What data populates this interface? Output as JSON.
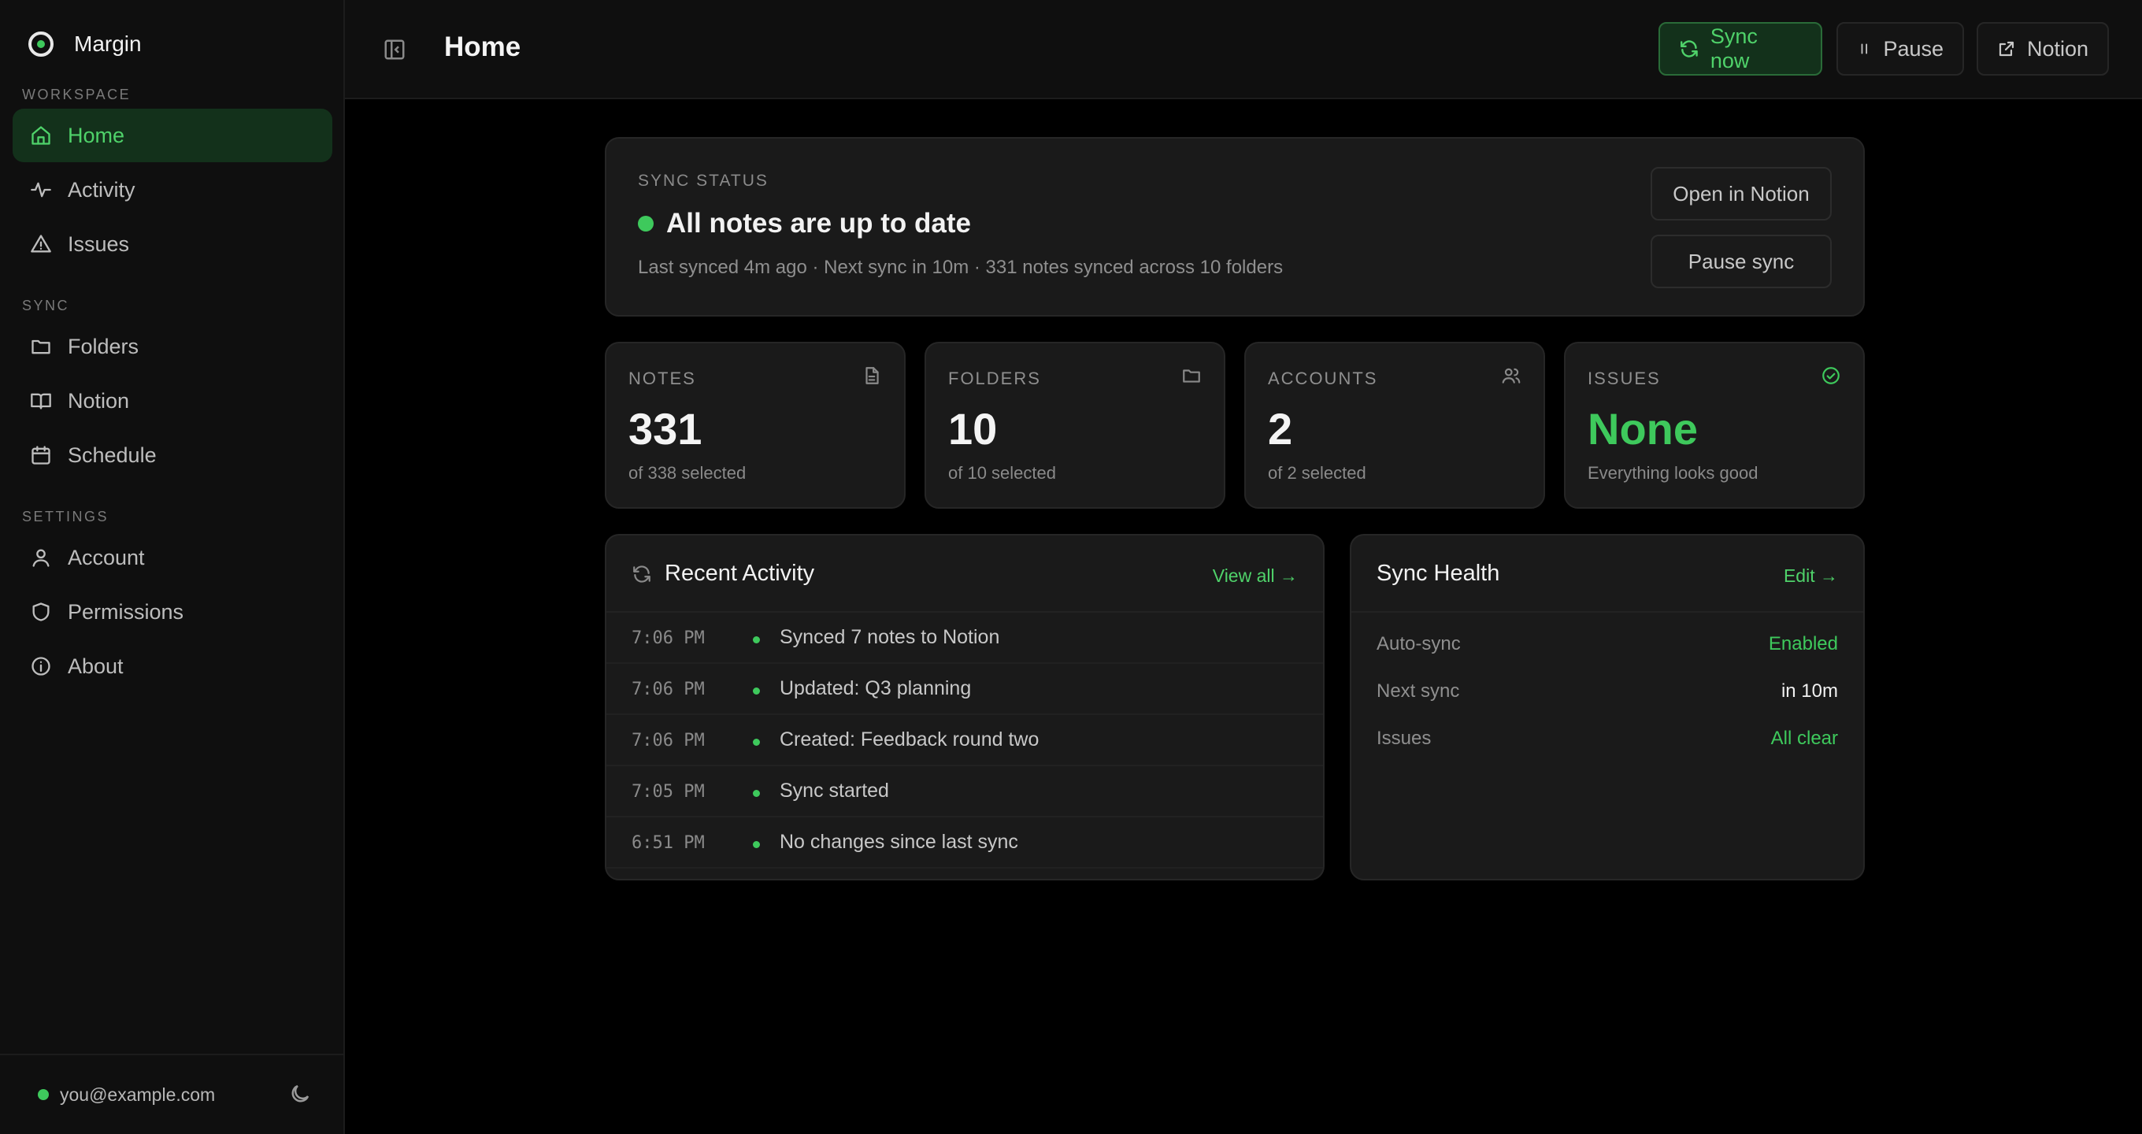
{
  "app": {
    "name": "Margin"
  },
  "sidebar": {
    "sections": [
      {
        "label": "WORKSPACE",
        "items": [
          {
            "label": "Home",
            "icon": "home-icon",
            "active": true
          },
          {
            "label": "Activity",
            "icon": "activity-icon"
          },
          {
            "label": "Issues",
            "icon": "warning-icon"
          }
        ]
      },
      {
        "label": "SYNC",
        "items": [
          {
            "label": "Folders",
            "icon": "folder-icon"
          },
          {
            "label": "Notion",
            "icon": "book-icon"
          },
          {
            "label": "Schedule",
            "icon": "calendar-icon"
          }
        ]
      },
      {
        "label": "SETTINGS",
        "items": [
          {
            "label": "Account",
            "icon": "user-icon"
          },
          {
            "label": "Permissions",
            "icon": "shield-icon"
          },
          {
            "label": "About",
            "icon": "info-icon"
          }
        ]
      }
    ],
    "footer": {
      "email": "you@example.com",
      "theme_icon": "moon-icon"
    }
  },
  "topbar": {
    "title": "Home",
    "buttons": {
      "sync": "Sync now",
      "pause": "Pause",
      "notion": "Notion"
    }
  },
  "status": {
    "eyebrow": "SYNC STATUS",
    "headline": "All notes are up to date",
    "meta": "Last synced 4m ago · Next sync in 10m · 331 notes synced across 10 folders",
    "open_button": "Open in Notion",
    "pause_button": "Pause sync"
  },
  "stats": [
    {
      "label": "NOTES",
      "value": "331",
      "sub": "of 338 selected",
      "icon": "document-icon"
    },
    {
      "label": "FOLDERS",
      "value": "10",
      "sub": "of 10 selected",
      "icon": "folder-icon"
    },
    {
      "label": "ACCOUNTS",
      "value": "2",
      "sub": "of 2 selected",
      "icon": "users-icon"
    },
    {
      "label": "ISSUES",
      "value": "None",
      "sub": "Everything looks good",
      "icon": "check-circle-icon"
    }
  ],
  "activity": {
    "title": "Recent Activity",
    "link": "View all →",
    "rows": [
      {
        "time": "7:06 PM",
        "text": "Synced 7 notes to Notion"
      },
      {
        "time": "7:06 PM",
        "text": "Updated: Q3 planning"
      },
      {
        "time": "7:06 PM",
        "text": "Created: Feedback round two"
      },
      {
        "time": "7:05 PM",
        "text": "Sync started"
      },
      {
        "time": "6:51 PM",
        "text": "No changes since last sync"
      }
    ]
  },
  "health": {
    "title": "Sync Health",
    "link": "Edit →",
    "rows": [
      {
        "key": "Auto-sync",
        "value": "Enabled"
      },
      {
        "key": "Next sync",
        "value": "in 10m"
      },
      {
        "key": "Issues",
        "value": "All clear"
      }
    ]
  },
  "colors": {
    "accent": "#3ec95c",
    "background": "#000000",
    "surface": "#1a1a1a",
    "sidebar": "#0f0f0f"
  }
}
